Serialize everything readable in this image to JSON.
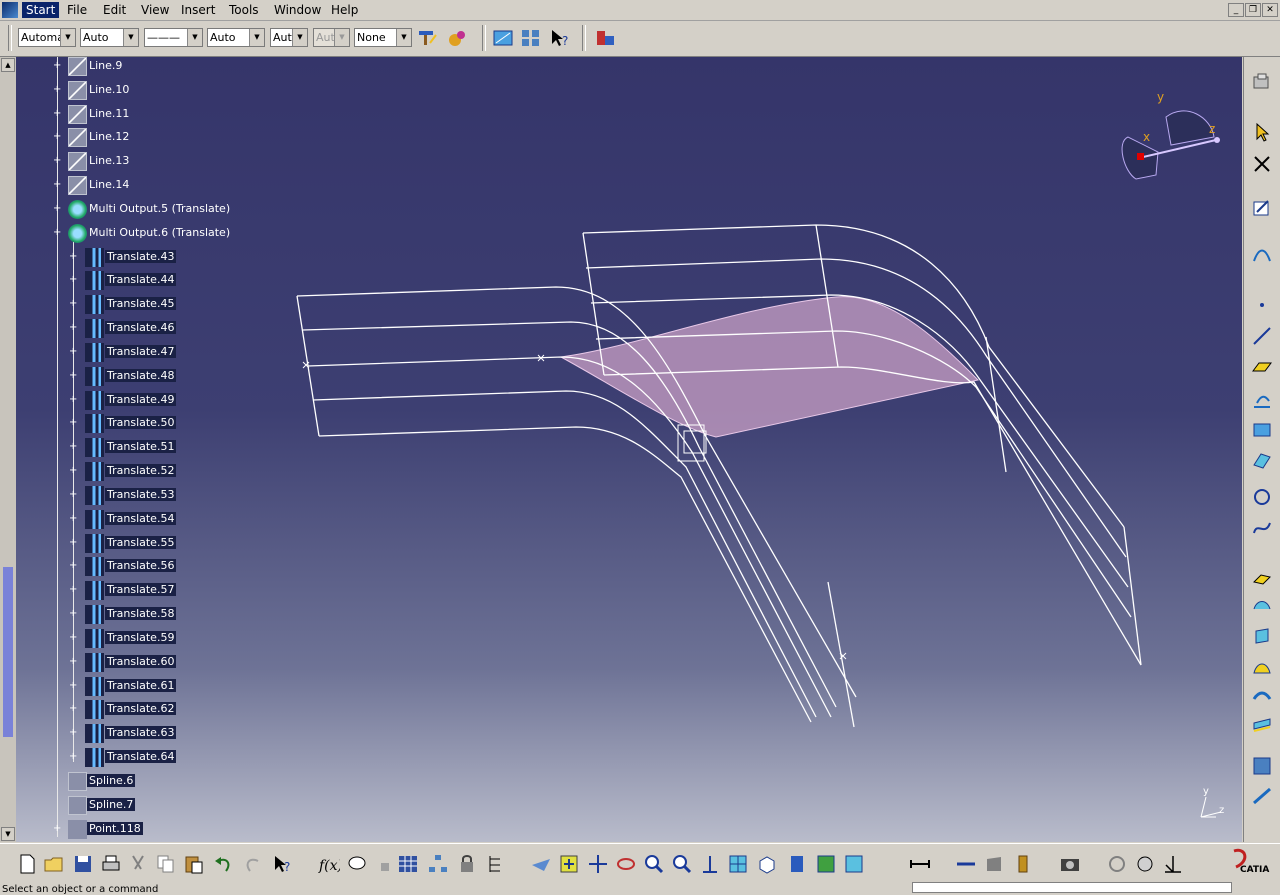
{
  "menu": {
    "items": [
      "Start",
      "File",
      "Edit",
      "View",
      "Insert",
      "Tools",
      "Window",
      "Help"
    ]
  },
  "toolbar": {
    "combos": [
      {
        "value": "Automa",
        "disabled": false
      },
      {
        "value": "Auto",
        "disabled": false
      },
      {
        "value": "———",
        "disabled": false
      },
      {
        "value": "Auto",
        "disabled": false
      },
      {
        "value": "Aut",
        "disabled": false
      },
      {
        "value": "Aut",
        "disabled": true
      },
      {
        "value": "None",
        "disabled": false
      }
    ]
  },
  "tree": {
    "nodes": [
      {
        "label": "Line.9",
        "icon": "line-icon",
        "selected": false
      },
      {
        "label": "Line.10",
        "icon": "line-icon",
        "selected": false
      },
      {
        "label": "Line.11",
        "icon": "line-icon",
        "selected": false
      },
      {
        "label": "Line.12",
        "icon": "line-icon",
        "selected": false
      },
      {
        "label": "Line.13",
        "icon": "line-icon",
        "selected": false
      },
      {
        "label": "Line.14",
        "icon": "line-icon",
        "selected": false
      },
      {
        "label": "Multi Output.5 (Translate)",
        "icon": "multi-output-icon",
        "selected": false
      },
      {
        "label": "Multi Output.6 (Translate)",
        "icon": "multi-output-icon",
        "selected": false
      },
      {
        "label": "Translate.43",
        "icon": "translate-icon",
        "selected": true
      },
      {
        "label": "Translate.44",
        "icon": "translate-icon",
        "selected": true
      },
      {
        "label": "Translate.45",
        "icon": "translate-icon",
        "selected": true
      },
      {
        "label": "Translate.46",
        "icon": "translate-icon",
        "selected": true
      },
      {
        "label": "Translate.47",
        "icon": "translate-icon",
        "selected": true
      },
      {
        "label": "Translate.48",
        "icon": "translate-icon",
        "selected": true
      },
      {
        "label": "Translate.49",
        "icon": "translate-icon",
        "selected": true
      },
      {
        "label": "Translate.50",
        "icon": "translate-icon",
        "selected": true
      },
      {
        "label": "Translate.51",
        "icon": "translate-icon",
        "selected": true
      },
      {
        "label": "Translate.52",
        "icon": "translate-icon",
        "selected": true
      },
      {
        "label": "Translate.53",
        "icon": "translate-icon",
        "selected": true
      },
      {
        "label": "Translate.54",
        "icon": "translate-icon",
        "selected": true
      },
      {
        "label": "Translate.55",
        "icon": "translate-icon",
        "selected": true
      },
      {
        "label": "Translate.56",
        "icon": "translate-icon",
        "selected": true
      },
      {
        "label": "Translate.57",
        "icon": "translate-icon",
        "selected": true
      },
      {
        "label": "Translate.58",
        "icon": "translate-icon",
        "selected": true
      },
      {
        "label": "Translate.59",
        "icon": "translate-icon",
        "selected": true
      },
      {
        "label": "Translate.60",
        "icon": "translate-icon",
        "selected": true
      },
      {
        "label": "Translate.61",
        "icon": "translate-icon",
        "selected": true
      },
      {
        "label": "Translate.62",
        "icon": "translate-icon",
        "selected": true
      },
      {
        "label": "Translate.63",
        "icon": "translate-icon",
        "selected": true
      },
      {
        "label": "Translate.64",
        "icon": "translate-icon",
        "selected": true
      },
      {
        "label": "Spline.6",
        "icon": "spline-icon",
        "selected": true
      },
      {
        "label": "Spline.7",
        "icon": "spline-icon",
        "selected": true
      },
      {
        "label": "Point.118",
        "icon": "point-icon",
        "selected": true
      }
    ]
  },
  "compass": {
    "x_label": "x",
    "y_label": "y",
    "z_label": "z"
  },
  "axis_triad": {
    "y_label": "y",
    "z_label": "z"
  },
  "brand": {
    "logo_text": "CATIA"
  },
  "status": {
    "message": "Select an object or a command"
  },
  "colors": {
    "background_top": "#35356a",
    "background_bottom": "#b9bccb",
    "surface": "#c9a0c6",
    "selection": "#1a2145"
  }
}
